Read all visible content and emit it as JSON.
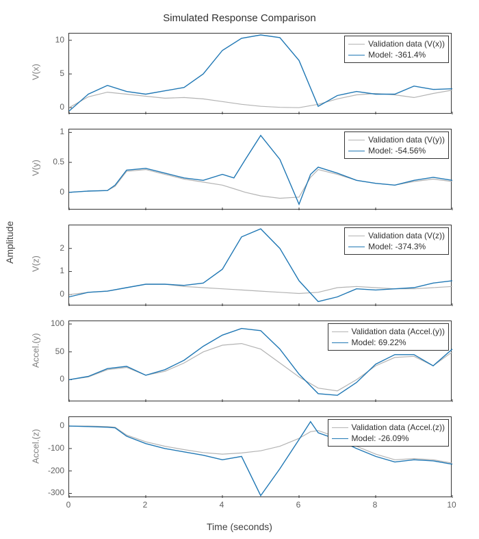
{
  "title": "Simulated Response Comparison",
  "x_super": "Time (seconds)",
  "y_super": "Amplitude",
  "x_domain": [
    0,
    10
  ],
  "x_ticks": [
    0,
    2,
    4,
    6,
    8,
    10
  ],
  "colors": {
    "validation": "#b3b3b3",
    "model": "#1f77b4"
  },
  "chart_data": [
    {
      "ylabel": "V(x)",
      "ylim": [
        -1,
        11
      ],
      "yticks": [
        0,
        5,
        10
      ],
      "legend": {
        "validation": "Validation data (V(x))",
        "model": "Model: -361.4%"
      },
      "x": [
        0,
        0.5,
        1,
        1.5,
        2,
        2.5,
        3,
        3.5,
        4,
        4.5,
        5,
        5.5,
        6,
        6.5,
        7,
        7.5,
        8,
        8.5,
        9,
        9.5,
        10
      ],
      "series": [
        {
          "name": "validation",
          "y": [
            0,
            1.6,
            2.3,
            2.0,
            1.7,
            1.4,
            1.5,
            1.3,
            0.9,
            0.5,
            0.2,
            0.05,
            0.0,
            0.5,
            1.3,
            1.9,
            2.1,
            1.9,
            1.5,
            2.1,
            2.6
          ]
        },
        {
          "name": "model",
          "y": [
            -0.5,
            2.0,
            3.3,
            2.4,
            2.0,
            2.5,
            3.0,
            5.0,
            8.5,
            10.3,
            10.8,
            10.4,
            7.0,
            0.2,
            1.8,
            2.4,
            2.0,
            2.0,
            3.2,
            2.7,
            2.8
          ]
        }
      ]
    },
    {
      "ylabel": "V(y)",
      "ylim": [
        -0.3,
        1.05
      ],
      "yticks": [
        0,
        0.5,
        1
      ],
      "legend": {
        "validation": "Validation data (V(y))",
        "model": "Model: -54.56%"
      },
      "x": [
        0,
        0.5,
        1,
        1.2,
        1.5,
        2,
        2.5,
        3,
        3.5,
        4,
        4.3,
        4.6,
        5,
        5.5,
        6,
        6.3,
        6.5,
        7,
        7.5,
        8,
        8.5,
        9,
        9.5,
        10
      ],
      "series": [
        {
          "name": "validation",
          "y": [
            0,
            0.02,
            0.03,
            0.1,
            0.35,
            0.38,
            0.3,
            0.22,
            0.17,
            0.12,
            0.06,
            0.0,
            -0.06,
            -0.1,
            -0.08,
            0.25,
            0.38,
            0.3,
            0.2,
            0.15,
            0.12,
            0.18,
            0.22,
            0.18
          ]
        },
        {
          "name": "model",
          "y": [
            0,
            0.02,
            0.03,
            0.12,
            0.37,
            0.4,
            0.32,
            0.24,
            0.2,
            0.3,
            0.24,
            0.55,
            0.95,
            0.55,
            -0.2,
            0.3,
            0.42,
            0.32,
            0.2,
            0.15,
            0.12,
            0.2,
            0.25,
            0.2
          ]
        }
      ]
    },
    {
      "ylabel": "V(z)",
      "ylim": [
        -0.5,
        3
      ],
      "yticks": [
        0,
        1,
        2
      ],
      "legend": {
        "validation": "Validation data (V(z))",
        "model": "Model: -374.3%"
      },
      "x": [
        0,
        0.5,
        1,
        1.5,
        2,
        2.5,
        3,
        3.5,
        4,
        4.5,
        5,
        5.5,
        6,
        6.5,
        7,
        7.5,
        8,
        8.5,
        9,
        9.5,
        10
      ],
      "series": [
        {
          "name": "validation",
          "y": [
            0,
            0.1,
            0.15,
            0.3,
            0.45,
            0.45,
            0.35,
            0.3,
            0.25,
            0.2,
            0.15,
            0.1,
            0.05,
            0.1,
            0.3,
            0.35,
            0.3,
            0.25,
            0.25,
            0.3,
            0.35
          ]
        },
        {
          "name": "model",
          "y": [
            -0.1,
            0.1,
            0.15,
            0.3,
            0.45,
            0.45,
            0.4,
            0.5,
            1.1,
            2.5,
            2.85,
            2.0,
            0.6,
            -0.3,
            -0.1,
            0.25,
            0.2,
            0.25,
            0.3,
            0.5,
            0.6
          ]
        }
      ]
    },
    {
      "ylabel": "Accel.(y)",
      "ylim": [
        -40,
        105
      ],
      "yticks": [
        0,
        50,
        100
      ],
      "legend": {
        "validation": "Validation data (Accel.(y))",
        "model": "Model: 69.22%"
      },
      "x": [
        0,
        0.5,
        1,
        1.5,
        2,
        2.5,
        3,
        3.5,
        4,
        4.5,
        5,
        5.5,
        6,
        6.5,
        7,
        7.5,
        8,
        8.5,
        9,
        9.5,
        10
      ],
      "series": [
        {
          "name": "validation",
          "y": [
            0,
            5,
            18,
            22,
            8,
            15,
            30,
            50,
            62,
            65,
            55,
            30,
            5,
            -15,
            -20,
            0,
            25,
            40,
            42,
            25,
            50
          ]
        },
        {
          "name": "model",
          "y": [
            0,
            6,
            20,
            24,
            8,
            18,
            35,
            60,
            80,
            92,
            88,
            55,
            10,
            -25,
            -28,
            -5,
            28,
            45,
            45,
            25,
            55
          ]
        }
      ]
    },
    {
      "ylabel": "Accel.(z)",
      "ylim": [
        -320,
        40
      ],
      "yticks": [
        -300,
        -200,
        -100,
        0
      ],
      "legend": {
        "validation": "Validation data (Accel.(z))",
        "model": "Model: -26.09%"
      },
      "x": [
        0,
        0.5,
        1,
        1.2,
        1.5,
        2,
        2.5,
        3,
        3.5,
        4,
        4.5,
        5,
        5.5,
        6,
        6.3,
        6.5,
        7,
        7.5,
        8,
        8.5,
        9,
        9.5,
        10
      ],
      "series": [
        {
          "name": "validation",
          "y": [
            0,
            0,
            -2,
            -5,
            -40,
            -70,
            -90,
            -105,
            -118,
            -125,
            -120,
            -110,
            -90,
            -55,
            -25,
            -20,
            -50,
            -90,
            -125,
            -150,
            -145,
            -150,
            -165
          ]
        },
        {
          "name": "model",
          "y": [
            0,
            -2,
            -5,
            -8,
            -45,
            -78,
            -100,
            -115,
            -130,
            -150,
            -135,
            -310,
            -190,
            -60,
            20,
            -30,
            -60,
            -100,
            -135,
            -160,
            -150,
            -155,
            -170
          ]
        }
      ]
    }
  ]
}
